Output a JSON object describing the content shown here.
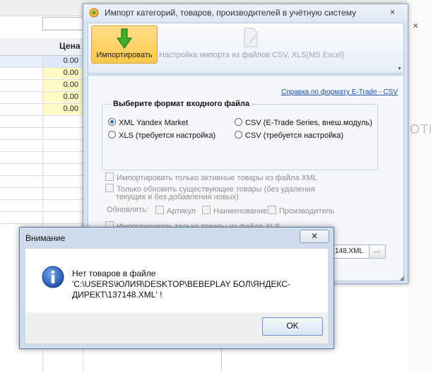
{
  "background": {
    "price_header": "Цена",
    "rows": [
      "0.00",
      "0.00",
      "0.00",
      "0.00",
      "0.00"
    ],
    "partial_text": "ОТК",
    "close_glyph": "×"
  },
  "import_window": {
    "title": "Импорт категорий, товаров, производителей в учётную систему",
    "close_glyph": "×",
    "ribbon": {
      "import_label": "Импортировать",
      "settings_label": "Настройка импорта из файлов CSV, XLS(MS Excel)"
    },
    "help_link": "Справка по формату E-Trade - CSV",
    "format_group": {
      "title": "Выберите формат входного файла",
      "options": [
        {
          "label": "XML Yandex Market",
          "selected": true
        },
        {
          "label": "CSV (E-Trade Series, внеш.модуль)",
          "selected": false
        },
        {
          "label": "XLS (требуется настройка)",
          "selected": false
        },
        {
          "label": "CSV (требуется настройка)",
          "selected": false
        }
      ]
    },
    "checkboxes": {
      "only_active": "Импортировать только активные товары из файла XML",
      "only_update_line1": "Только обновить существующие товары (без удаления",
      "only_update_line2": "текущих и без добавления новых)",
      "update_label": "Обновлять:",
      "article": "Артикул",
      "name": "Наименование",
      "manufacturer": "Производитель",
      "only_xls": "Импортировать только товары из файла XLS"
    },
    "file_value": "148.XML",
    "browse_label": "..."
  },
  "alert": {
    "title": "Внимание",
    "close_glyph": "✕",
    "message": "Нет товаров в файле 'C:\\USERS\\ЮЛИЯ\\DESKTOP\\BEBEPLAY БОЛ\\ЯНДЕКС-ДИРЕКТ\\137148.XML' !",
    "ok_label": "OK"
  },
  "colors": {
    "accent_button": "#ffc84a",
    "info_icon": "#2457b8",
    "link": "#1b4fa8"
  }
}
